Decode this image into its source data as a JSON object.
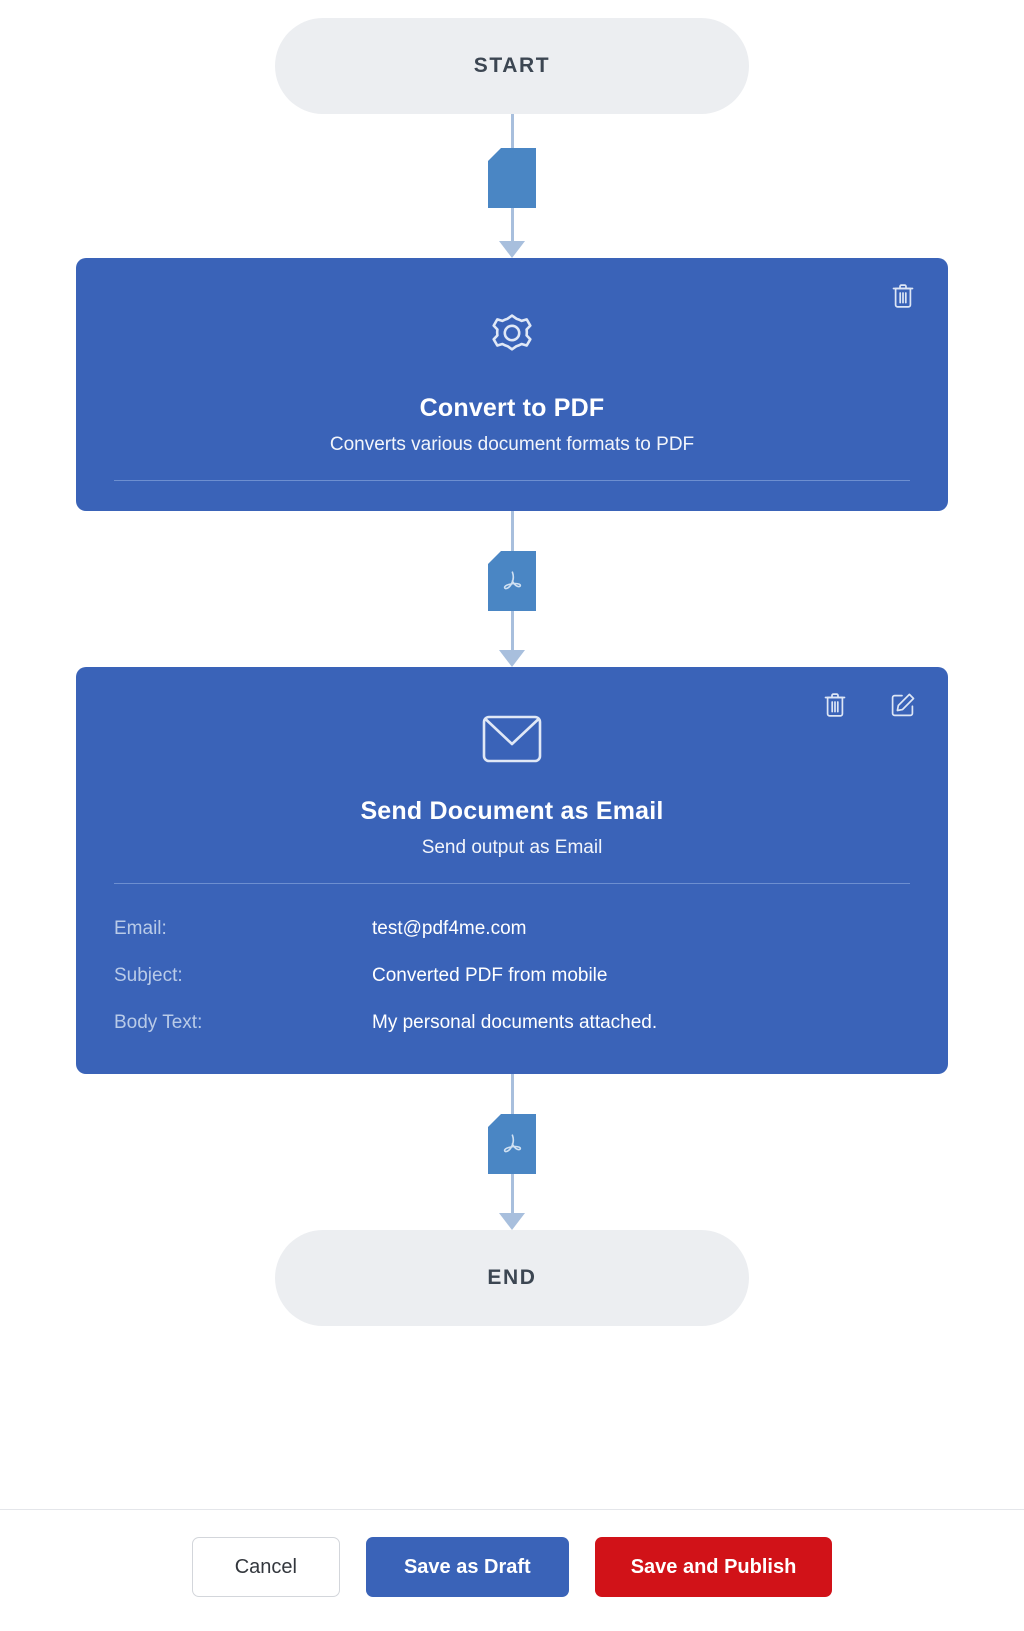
{
  "flow": {
    "start_label": "START",
    "end_label": "END",
    "connectors": [
      {
        "icon": "document-icon"
      },
      {
        "icon": "pdf-file-icon"
      },
      {
        "icon": "pdf-file-icon"
      }
    ],
    "steps": [
      {
        "icon": "gear-icon",
        "title": "Convert to PDF",
        "subtitle": "Converts various document formats to PDF",
        "tools": [
          "delete-icon"
        ],
        "details": []
      },
      {
        "icon": "envelope-icon",
        "title": "Send Document as Email",
        "subtitle": "Send output as Email",
        "tools": [
          "delete-icon",
          "edit-icon"
        ],
        "details": [
          {
            "label": "Email:",
            "value": "test@pdf4me.com"
          },
          {
            "label": "Subject:",
            "value": "Converted PDF from mobile"
          },
          {
            "label": "Body Text:",
            "value": "My personal documents attached."
          }
        ]
      }
    ]
  },
  "footer": {
    "cancel_label": "Cancel",
    "draft_label": "Save as Draft",
    "publish_label": "Save and Publish"
  },
  "colors": {
    "card_blue": "#3a63b8",
    "terminal_gray": "#eceef1",
    "connector_blue": "#a8bfdd",
    "chip_blue": "#4a86c4",
    "publish_red": "#d11218"
  }
}
